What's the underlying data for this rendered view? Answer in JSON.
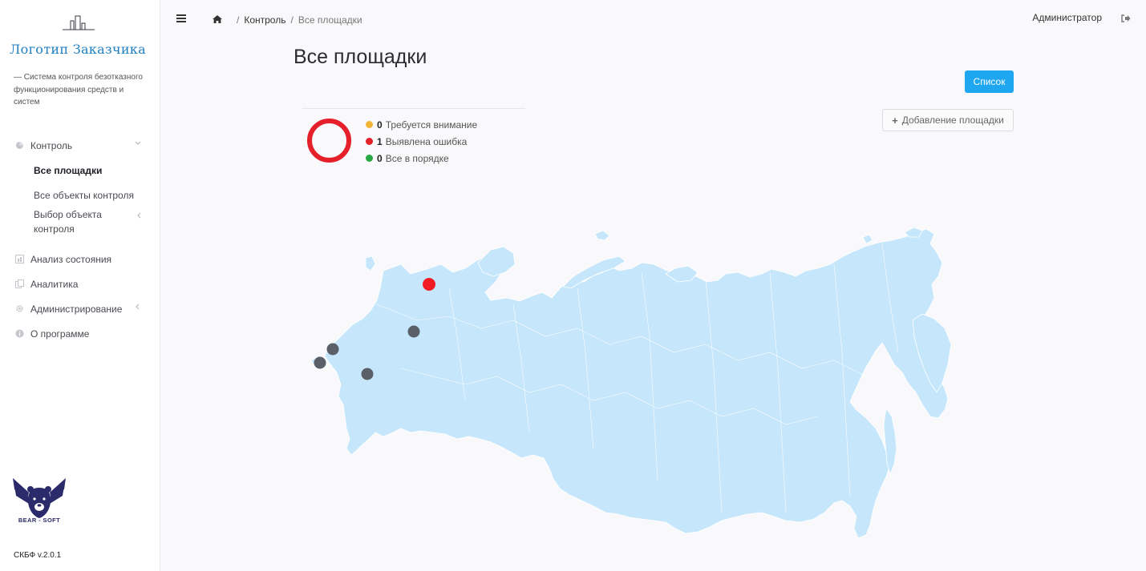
{
  "brand": {
    "logo_text": "Логотип Заказчика",
    "tagline": "— Система контроля безотказного функционирования средств и систем",
    "vendor": "BEAR - SOFT",
    "version": "СКБФ v.2.0.1"
  },
  "sidebar": {
    "items": [
      {
        "label": "Контроль",
        "icon": "monitor-icon",
        "chevron": "chevron-down-icon"
      },
      {
        "label": "Все площадки",
        "sub": true,
        "active": true
      },
      {
        "label": "Все объекты контроля",
        "sub": true
      },
      {
        "label": "Выбор объекта контроля",
        "sub": true,
        "chevron": "chevron-left-icon"
      },
      {
        "label": "Анализ состояния",
        "icon": "chart-icon"
      },
      {
        "label": "Аналитика",
        "icon": "copy-icon"
      },
      {
        "label": "Администрирование",
        "icon": "gear-icon",
        "chevron": "chevron-left-icon"
      },
      {
        "label": "О программе",
        "icon": "info-icon"
      }
    ]
  },
  "header": {
    "breadcrumb": [
      "Контроль",
      "Все площадки"
    ],
    "user": "Администратор"
  },
  "main": {
    "title": "Все площадки",
    "list_button": "Список",
    "add_button": "Добавление площадки",
    "legend": [
      {
        "count": "0",
        "label": "Требуется внимание",
        "color": "#f1b434"
      },
      {
        "count": "1",
        "label": "Выявлена ошибка",
        "color": "#e5202a"
      },
      {
        "count": "0",
        "label": "Все в порядке",
        "color": "#28a745"
      }
    ],
    "status_donut": {
      "attention": 0,
      "error": 1,
      "ok": 0
    }
  },
  "colors": {
    "accent": "#1ea7f0",
    "map_fill": "#c6e7fb",
    "site_error": "#f21c24",
    "site_neutral": "#5a5f68"
  }
}
